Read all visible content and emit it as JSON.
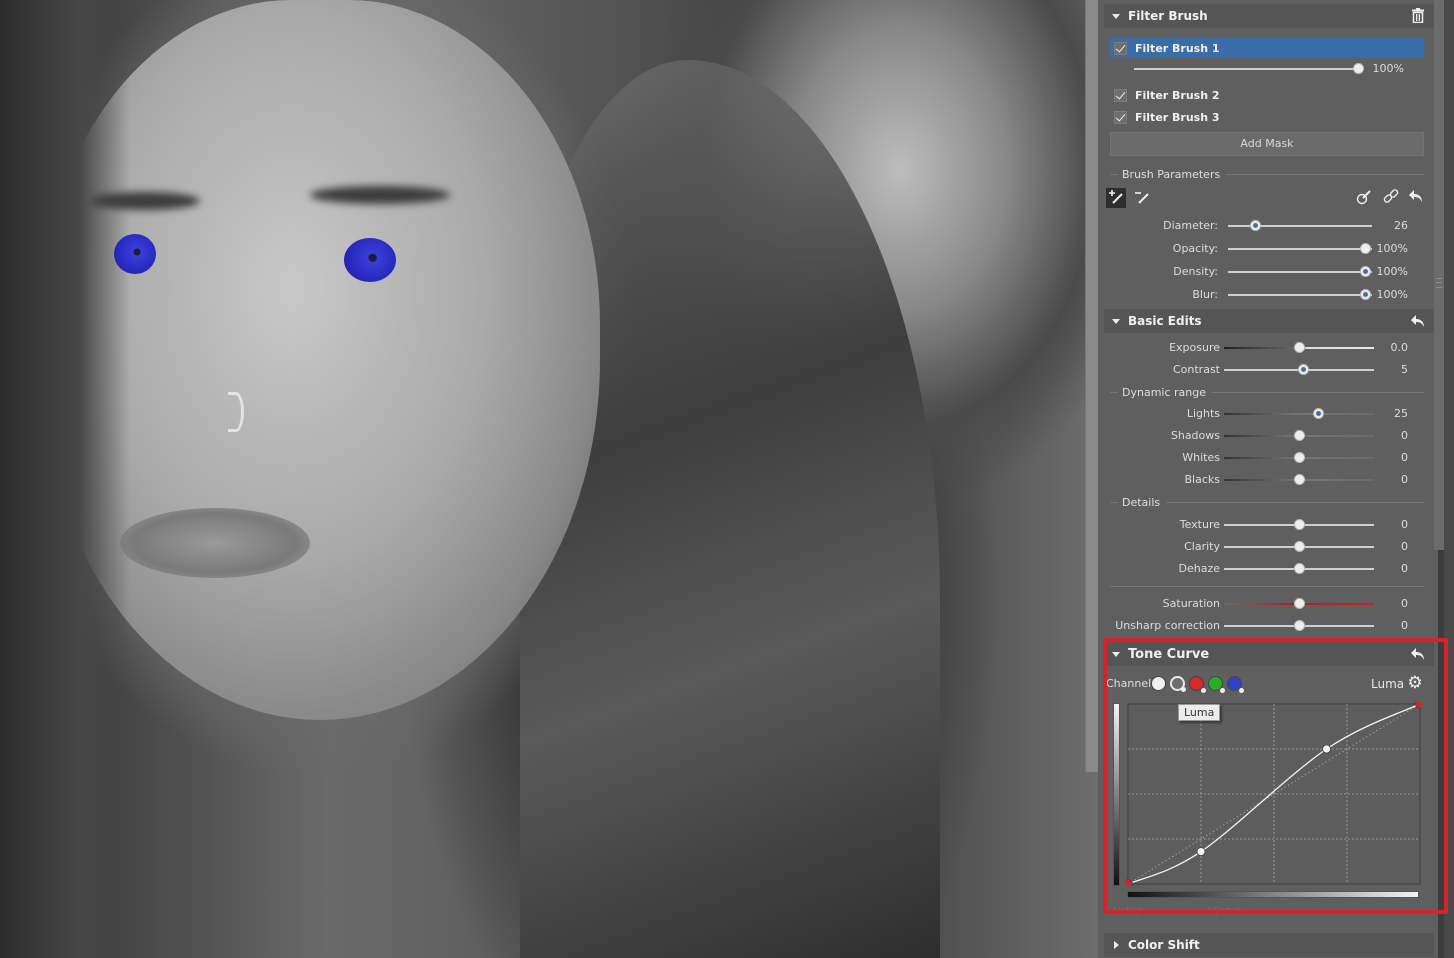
{
  "photo": {
    "description": "black and white portrait with blue-colored eyes (filter brush mask)",
    "eye_color": "#2a2cc8"
  },
  "filter_brush": {
    "title": "Filter Brush",
    "items": [
      {
        "label": "Filter Brush 1",
        "checked": true,
        "selected": true,
        "amount": "100%"
      },
      {
        "label": "Filter Brush 2",
        "checked": true,
        "selected": false
      },
      {
        "label": "Filter Brush 3",
        "checked": true,
        "selected": false
      }
    ],
    "add_mask_label": "Add Mask",
    "brush_parameters_label": "Brush Parameters",
    "params": [
      {
        "label": "Diameter:",
        "value": "26",
        "fraction": 0.19,
        "modified": true
      },
      {
        "label": "Opacity:",
        "value": "100%",
        "fraction": 0.95,
        "modified": false
      },
      {
        "label": "Density:",
        "value": "100%",
        "fraction": 0.95,
        "modified": true
      },
      {
        "label": "Blur:",
        "value": "100%",
        "fraction": 0.95,
        "modified": true
      }
    ]
  },
  "basic_edits": {
    "title": "Basic Edits",
    "rows": [
      {
        "label": "Exposure",
        "value": "0.0",
        "fraction": 0.5,
        "modified": false,
        "track": "dark"
      },
      {
        "label": "Contrast",
        "value": "5",
        "fraction": 0.525,
        "modified": true,
        "track": "plain"
      }
    ],
    "dynamic_range_label": "Dynamic range",
    "dynamic_range": [
      {
        "label": "Lights",
        "value": "25",
        "fraction": 0.625,
        "modified": true,
        "track": "dim"
      },
      {
        "label": "Shadows",
        "value": "0",
        "fraction": 0.5,
        "modified": false,
        "track": "dim"
      },
      {
        "label": "Whites",
        "value": "0",
        "fraction": 0.5,
        "modified": false,
        "track": "dim"
      },
      {
        "label": "Blacks",
        "value": "0",
        "fraction": 0.5,
        "modified": false,
        "track": "dim"
      }
    ],
    "details_label": "Details",
    "details": [
      {
        "label": "Texture",
        "value": "0",
        "fraction": 0.5,
        "modified": false,
        "track": "plain"
      },
      {
        "label": "Clarity",
        "value": "0",
        "fraction": 0.5,
        "modified": false,
        "track": "plain"
      },
      {
        "label": "Dehaze",
        "value": "0",
        "fraction": 0.5,
        "modified": false,
        "track": "plain"
      }
    ],
    "other": [
      {
        "label": "Saturation",
        "value": "0",
        "fraction": 0.5,
        "modified": false,
        "track": "red"
      },
      {
        "label": "Unsharp correction",
        "value": "0",
        "fraction": 0.5,
        "modified": false,
        "track": "plain"
      }
    ]
  },
  "tone_curve": {
    "title": "Tone Curve",
    "channel_label": "Channel:",
    "channels": [
      {
        "name": "Luma",
        "color": "#f0f0f0"
      },
      {
        "name": "Luminance",
        "color": "#6e6e6e"
      },
      {
        "name": "Red",
        "color": "#d82828"
      },
      {
        "name": "Green",
        "color": "#22b022"
      },
      {
        "name": "Blue",
        "color": "#3040c8"
      }
    ],
    "active_channel": "Luma",
    "tooltip": "Luma",
    "points": [
      [
        0,
        0
      ],
      [
        0.25,
        0.18
      ],
      [
        0.68,
        0.75
      ],
      [
        1,
        1
      ]
    ],
    "hidden_field_labels": [
      "Vstup:",
      "Výstup:"
    ],
    "highlight_color": "#d8222a"
  },
  "color_shift": {
    "title": "Color Shift"
  }
}
